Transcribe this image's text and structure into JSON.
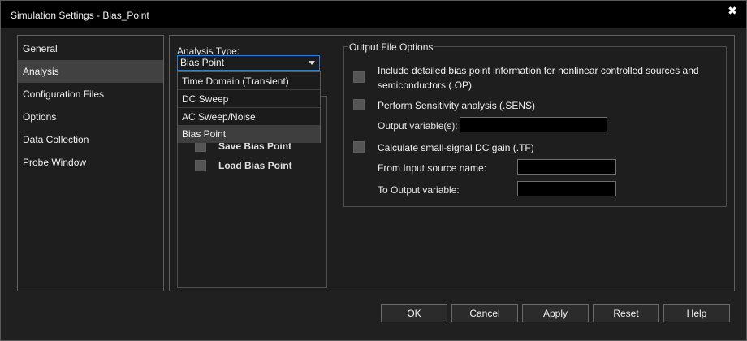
{
  "window": {
    "title": "Simulation Settings - Bias_Point",
    "close_glyph": "✖"
  },
  "nav": {
    "items": [
      {
        "label": "General"
      },
      {
        "label": "Analysis",
        "active": true
      },
      {
        "label": "Configuration Files"
      },
      {
        "label": "Options"
      },
      {
        "label": "Data Collection"
      },
      {
        "label": "Probe Window"
      }
    ]
  },
  "analysis": {
    "type_label": "Analysis Type:",
    "selected": "Bias Point",
    "options": [
      "Time Domain (Transient)",
      "DC Sweep",
      "AC Sweep/Noise",
      "Bias Point"
    ],
    "left_options": [
      {
        "label": "Save Bias Point",
        "checked": false
      },
      {
        "label": "Load Bias Point",
        "checked": false
      }
    ]
  },
  "output_options": {
    "legend": "Output File Options",
    "op": {
      "line1": "Include detailed bias point information for nonlinear controlled sources and",
      "line2": "semiconductors (.OP)",
      "checked": false
    },
    "sens": {
      "label": "Perform Sensitivity analysis (.SENS)",
      "checked": false,
      "output_variable_label": "Output variable(s):",
      "output_variable_value": ""
    },
    "tf": {
      "label": "Calculate small-signal DC gain (.TF)",
      "checked": false,
      "from_input_label": "From Input source name:",
      "from_input_value": "",
      "to_output_label": "To Output variable:",
      "to_output_value": ""
    }
  },
  "buttons": {
    "ok": "OK",
    "cancel": "Cancel",
    "apply": "Apply",
    "reset": "Reset",
    "help": "Help"
  },
  "colors": {
    "window_bg": "#202020",
    "titlebar_bg": "#000000",
    "accent_focus": "#2d7fd4",
    "active_nav": "#414141"
  }
}
